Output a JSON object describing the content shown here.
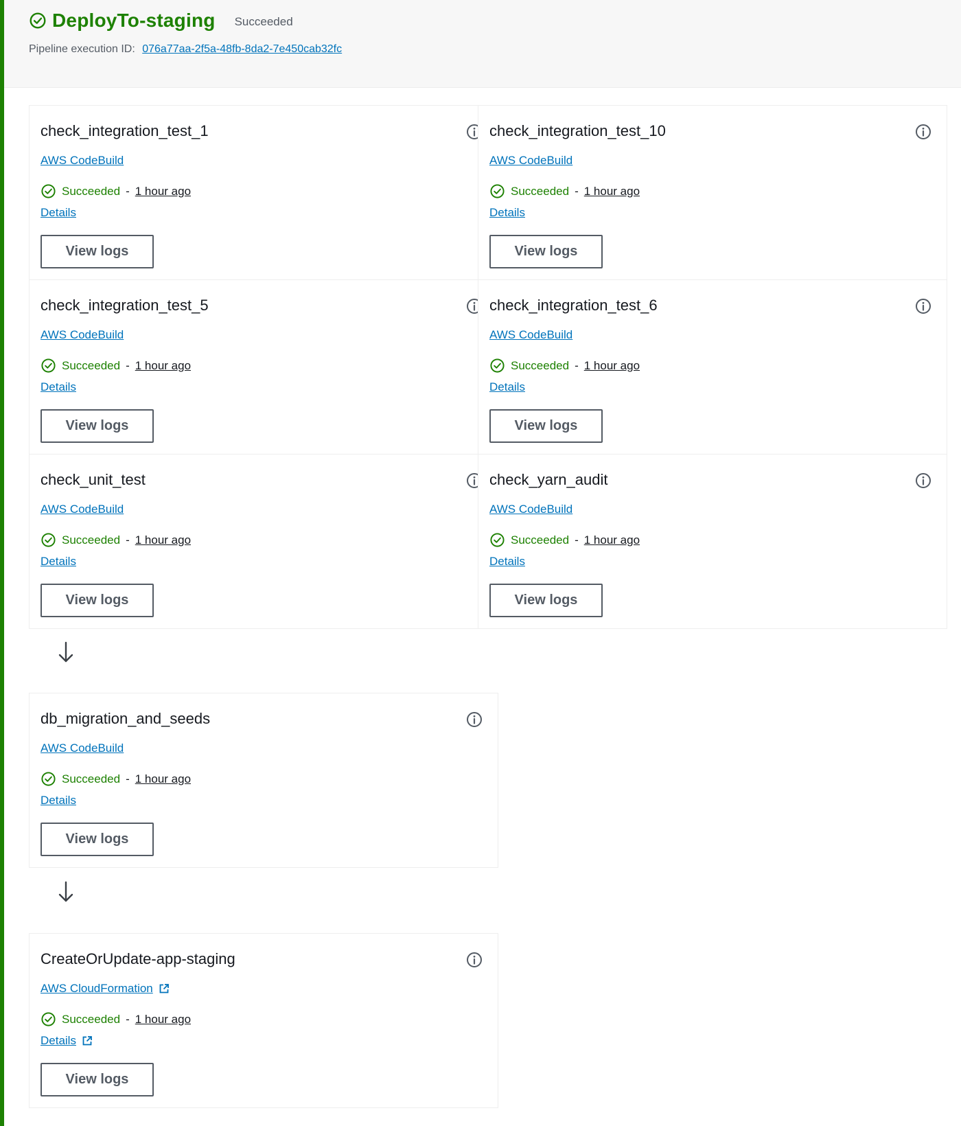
{
  "header": {
    "stage_name": "DeployTo-staging",
    "stage_status": "Succeeded",
    "execution_label": "Pipeline execution ID:",
    "execution_id": "076a77aa-2f5a-48fb-8da2-7e450cab32fc"
  },
  "actions": [
    {
      "name": "check_integration_test_1",
      "provider": "AWS CodeBuild",
      "status": "Succeeded",
      "separator": "-",
      "time": "1 hour ago",
      "details": "Details",
      "button": "View logs"
    },
    {
      "name": "check_integration_test_10",
      "provider": "AWS CodeBuild",
      "status": "Succeeded",
      "separator": "-",
      "time": "1 hour ago",
      "details": "Details",
      "button": "View logs"
    },
    {
      "name": "check_integration_test_5",
      "provider": "AWS CodeBuild",
      "status": "Succeeded",
      "separator": "-",
      "time": "1 hour ago",
      "details": "Details",
      "button": "View logs"
    },
    {
      "name": "check_integration_test_6",
      "provider": "AWS CodeBuild",
      "status": "Succeeded",
      "separator": "-",
      "time": "1 hour ago",
      "details": "Details",
      "button": "View logs"
    },
    {
      "name": "check_unit_test",
      "provider": "AWS CodeBuild",
      "status": "Succeeded",
      "separator": "-",
      "time": "1 hour ago",
      "details": "Details",
      "button": "View logs"
    },
    {
      "name": "check_yarn_audit",
      "provider": "AWS CodeBuild",
      "status": "Succeeded",
      "separator": "-",
      "time": "1 hour ago",
      "details": "Details",
      "button": "View logs"
    },
    {
      "name": "db_migration_and_seeds",
      "provider": "AWS CodeBuild",
      "status": "Succeeded",
      "separator": "-",
      "time": "1 hour ago",
      "details": "Details",
      "button": "View logs"
    },
    {
      "name": "CreateOrUpdate-app-staging",
      "provider": "AWS CloudFormation",
      "status": "Succeeded",
      "separator": "-",
      "time": "1 hour ago",
      "details": "Details",
      "button": "View logs"
    }
  ],
  "icons": {
    "status": "check-circle-icon",
    "info": "info-icon",
    "external": "external-link-icon",
    "transition": "arrow-down-icon"
  },
  "colors": {
    "success": "#1d8102",
    "link": "#0073bb",
    "text": "#16191f",
    "muted": "#545b64"
  }
}
